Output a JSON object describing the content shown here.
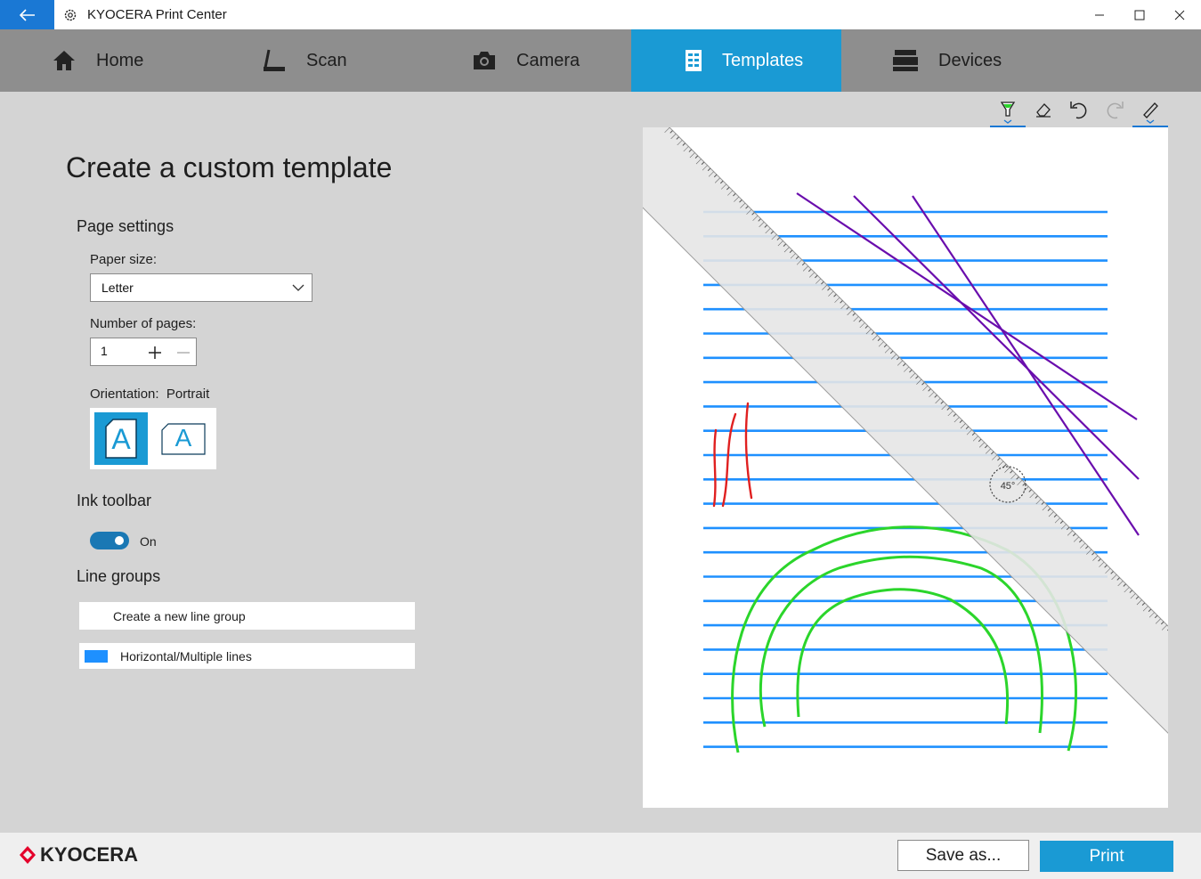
{
  "window": {
    "title": "KYOCERA Print Center"
  },
  "nav": {
    "tabs": [
      {
        "label": "Home",
        "icon": "home-icon"
      },
      {
        "label": "Scan",
        "icon": "scanner-icon"
      },
      {
        "label": "Camera",
        "icon": "camera-icon"
      },
      {
        "label": "Templates",
        "icon": "template-icon",
        "active": true
      },
      {
        "label": "Devices",
        "icon": "printer-icon"
      }
    ]
  },
  "page": {
    "title": "Create a custom template",
    "page_settings": {
      "heading": "Page settings",
      "paper_size_label": "Paper size:",
      "paper_size_value": "Letter",
      "pages_label": "Number of pages:",
      "pages_value": "1",
      "orientation_label": "Orientation:",
      "orientation_value": "Portrait",
      "orientation_glyph": "A"
    },
    "ink_toolbar": {
      "heading": "Ink toolbar",
      "toggle_label": "On",
      "enabled": true
    },
    "line_groups": {
      "heading": "Line groups",
      "create_label": "Create a new line group",
      "items": [
        {
          "label": "Horizontal/Multiple lines",
          "color": "#1e90ff"
        }
      ]
    }
  },
  "ruler": {
    "angle_label": "45°"
  },
  "footer": {
    "brand": "KYOCERA",
    "save_label": "Save as...",
    "print_label": "Print"
  },
  "colors": {
    "accent": "#1a9ad4",
    "nav_bg": "#8e8e8e",
    "line_blue": "#1e90ff",
    "ink_purple": "#6a0dad",
    "ink_red": "#e02020",
    "ink_green": "#2bd52b",
    "brand_red": "#e4002b"
  }
}
